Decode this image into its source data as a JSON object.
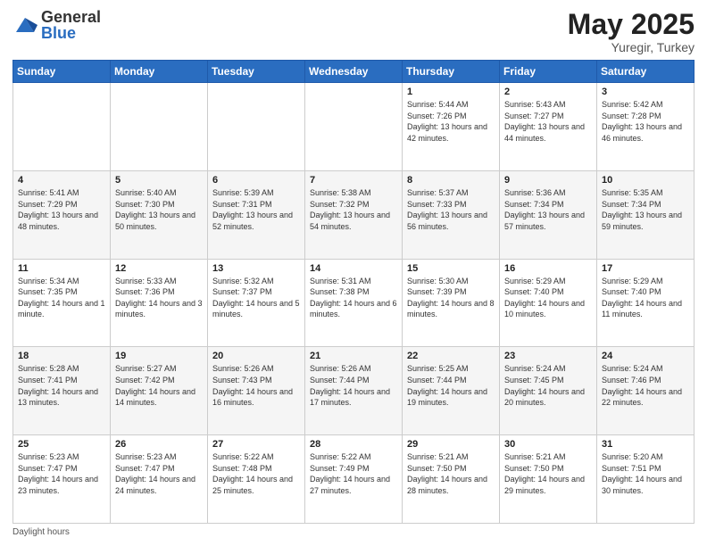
{
  "header": {
    "logo_general": "General",
    "logo_blue": "Blue",
    "title": "May 2025",
    "location": "Yuregir, Turkey"
  },
  "days_of_week": [
    "Sunday",
    "Monday",
    "Tuesday",
    "Wednesday",
    "Thursday",
    "Friday",
    "Saturday"
  ],
  "weeks": [
    [
      {
        "day": "",
        "info": ""
      },
      {
        "day": "",
        "info": ""
      },
      {
        "day": "",
        "info": ""
      },
      {
        "day": "",
        "info": ""
      },
      {
        "day": "1",
        "info": "Sunrise: 5:44 AM\nSunset: 7:26 PM\nDaylight: 13 hours and 42 minutes."
      },
      {
        "day": "2",
        "info": "Sunrise: 5:43 AM\nSunset: 7:27 PM\nDaylight: 13 hours and 44 minutes."
      },
      {
        "day": "3",
        "info": "Sunrise: 5:42 AM\nSunset: 7:28 PM\nDaylight: 13 hours and 46 minutes."
      }
    ],
    [
      {
        "day": "4",
        "info": "Sunrise: 5:41 AM\nSunset: 7:29 PM\nDaylight: 13 hours and 48 minutes."
      },
      {
        "day": "5",
        "info": "Sunrise: 5:40 AM\nSunset: 7:30 PM\nDaylight: 13 hours and 50 minutes."
      },
      {
        "day": "6",
        "info": "Sunrise: 5:39 AM\nSunset: 7:31 PM\nDaylight: 13 hours and 52 minutes."
      },
      {
        "day": "7",
        "info": "Sunrise: 5:38 AM\nSunset: 7:32 PM\nDaylight: 13 hours and 54 minutes."
      },
      {
        "day": "8",
        "info": "Sunrise: 5:37 AM\nSunset: 7:33 PM\nDaylight: 13 hours and 56 minutes."
      },
      {
        "day": "9",
        "info": "Sunrise: 5:36 AM\nSunset: 7:34 PM\nDaylight: 13 hours and 57 minutes."
      },
      {
        "day": "10",
        "info": "Sunrise: 5:35 AM\nSunset: 7:34 PM\nDaylight: 13 hours and 59 minutes."
      }
    ],
    [
      {
        "day": "11",
        "info": "Sunrise: 5:34 AM\nSunset: 7:35 PM\nDaylight: 14 hours and 1 minute."
      },
      {
        "day": "12",
        "info": "Sunrise: 5:33 AM\nSunset: 7:36 PM\nDaylight: 14 hours and 3 minutes."
      },
      {
        "day": "13",
        "info": "Sunrise: 5:32 AM\nSunset: 7:37 PM\nDaylight: 14 hours and 5 minutes."
      },
      {
        "day": "14",
        "info": "Sunrise: 5:31 AM\nSunset: 7:38 PM\nDaylight: 14 hours and 6 minutes."
      },
      {
        "day": "15",
        "info": "Sunrise: 5:30 AM\nSunset: 7:39 PM\nDaylight: 14 hours and 8 minutes."
      },
      {
        "day": "16",
        "info": "Sunrise: 5:29 AM\nSunset: 7:40 PM\nDaylight: 14 hours and 10 minutes."
      },
      {
        "day": "17",
        "info": "Sunrise: 5:29 AM\nSunset: 7:40 PM\nDaylight: 14 hours and 11 minutes."
      }
    ],
    [
      {
        "day": "18",
        "info": "Sunrise: 5:28 AM\nSunset: 7:41 PM\nDaylight: 14 hours and 13 minutes."
      },
      {
        "day": "19",
        "info": "Sunrise: 5:27 AM\nSunset: 7:42 PM\nDaylight: 14 hours and 14 minutes."
      },
      {
        "day": "20",
        "info": "Sunrise: 5:26 AM\nSunset: 7:43 PM\nDaylight: 14 hours and 16 minutes."
      },
      {
        "day": "21",
        "info": "Sunrise: 5:26 AM\nSunset: 7:44 PM\nDaylight: 14 hours and 17 minutes."
      },
      {
        "day": "22",
        "info": "Sunrise: 5:25 AM\nSunset: 7:44 PM\nDaylight: 14 hours and 19 minutes."
      },
      {
        "day": "23",
        "info": "Sunrise: 5:24 AM\nSunset: 7:45 PM\nDaylight: 14 hours and 20 minutes."
      },
      {
        "day": "24",
        "info": "Sunrise: 5:24 AM\nSunset: 7:46 PM\nDaylight: 14 hours and 22 minutes."
      }
    ],
    [
      {
        "day": "25",
        "info": "Sunrise: 5:23 AM\nSunset: 7:47 PM\nDaylight: 14 hours and 23 minutes."
      },
      {
        "day": "26",
        "info": "Sunrise: 5:23 AM\nSunset: 7:47 PM\nDaylight: 14 hours and 24 minutes."
      },
      {
        "day": "27",
        "info": "Sunrise: 5:22 AM\nSunset: 7:48 PM\nDaylight: 14 hours and 25 minutes."
      },
      {
        "day": "28",
        "info": "Sunrise: 5:22 AM\nSunset: 7:49 PM\nDaylight: 14 hours and 27 minutes."
      },
      {
        "day": "29",
        "info": "Sunrise: 5:21 AM\nSunset: 7:50 PM\nDaylight: 14 hours and 28 minutes."
      },
      {
        "day": "30",
        "info": "Sunrise: 5:21 AM\nSunset: 7:50 PM\nDaylight: 14 hours and 29 minutes."
      },
      {
        "day": "31",
        "info": "Sunrise: 5:20 AM\nSunset: 7:51 PM\nDaylight: 14 hours and 30 minutes."
      }
    ]
  ],
  "footer": {
    "daylight_hours_label": "Daylight hours"
  }
}
